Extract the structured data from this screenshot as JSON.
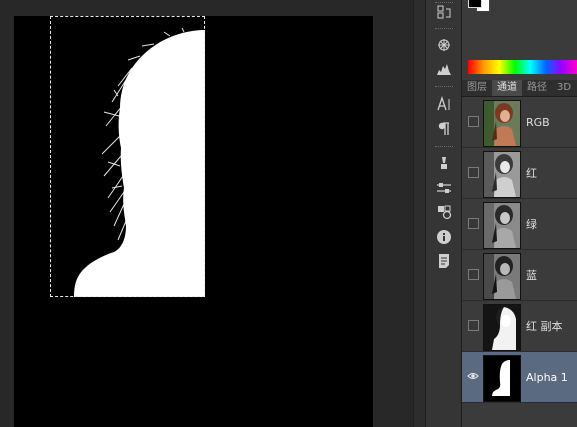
{
  "panel": {
    "tabs": [
      {
        "label": "图层",
        "active": false
      },
      {
        "label": "通道",
        "active": true
      },
      {
        "label": "路径",
        "active": false
      },
      {
        "label": "3D",
        "active": false
      }
    ]
  },
  "channels": [
    {
      "label": "RGB",
      "visible": false,
      "selected": false,
      "thumb_style": "color"
    },
    {
      "label": "红",
      "visible": false,
      "selected": false,
      "thumb_style": "gray-light"
    },
    {
      "label": "绿",
      "visible": false,
      "selected": false,
      "thumb_style": "gray-mid"
    },
    {
      "label": "蓝",
      "visible": false,
      "selected": false,
      "thumb_style": "gray-dark"
    },
    {
      "label": "红 副本",
      "visible": false,
      "selected": false,
      "thumb_style": "mask-soft"
    },
    {
      "label": "Alpha 1",
      "visible": true,
      "selected": true,
      "thumb_style": "mask"
    }
  ],
  "dock_tools": [
    {
      "icon": "history-icon"
    },
    {
      "icon": "brush-settings-icon"
    },
    {
      "icon": "histogram-icon"
    },
    {
      "icon": "character-icon"
    },
    {
      "icon": "paragraph-icon"
    },
    {
      "icon": "tool-presets-icon"
    },
    {
      "icon": "adjustments-icon"
    },
    {
      "icon": "clone-source-icon"
    },
    {
      "icon": "info-icon"
    },
    {
      "icon": "notes-icon"
    }
  ],
  "colors": {
    "selected_row": "#5a6a80",
    "panel_bg": "#3b3b3b",
    "canvas_bg": "#000000",
    "mask_fg": "#ffffff"
  }
}
